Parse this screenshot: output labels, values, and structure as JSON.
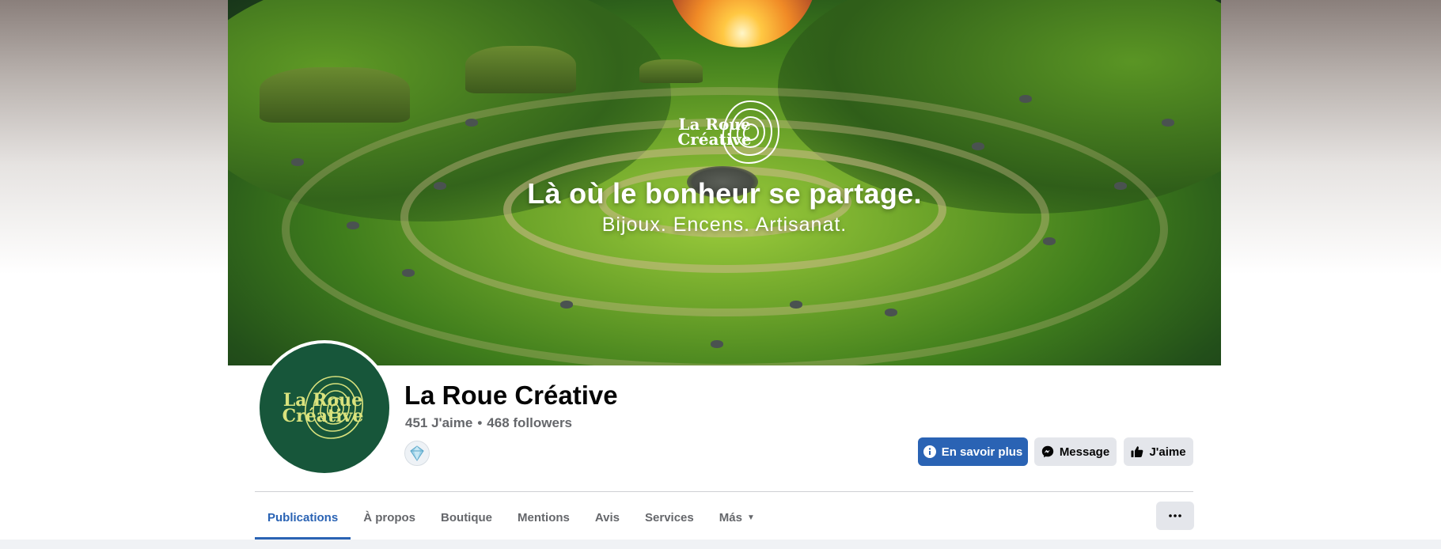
{
  "cover": {
    "logo_line1": "La Roue",
    "logo_line2": "Créative",
    "headline": "Là où le bonheur se partage.",
    "subline": "Bijoux. Encens. Artisanat."
  },
  "profile": {
    "avatar_line1": "La Roue",
    "avatar_line2": "Créative",
    "name": "La Roue Créative",
    "likes": "451 J'aime",
    "followers": "468 followers",
    "separator": "•"
  },
  "actions": {
    "learn_more": "En savoir plus",
    "message": "Message",
    "like": "J'aime"
  },
  "tabs": [
    {
      "label": "Publications",
      "active": true
    },
    {
      "label": "À propos"
    },
    {
      "label": "Boutique"
    },
    {
      "label": "Mentions"
    },
    {
      "label": "Avis"
    },
    {
      "label": "Services"
    },
    {
      "label": "Más"
    }
  ],
  "colors": {
    "accent": "#2a63b4",
    "brand_green": "#17563a",
    "brand_lime": "#d9e27d",
    "secondary_button": "#e4e6eb"
  },
  "icons": {
    "learn_more": "info-icon",
    "message": "messenger-icon",
    "like": "thumbs-up-icon",
    "more": "ellipsis-icon",
    "dropdown": "caret-down-icon",
    "badge": "gem-badge-icon"
  }
}
